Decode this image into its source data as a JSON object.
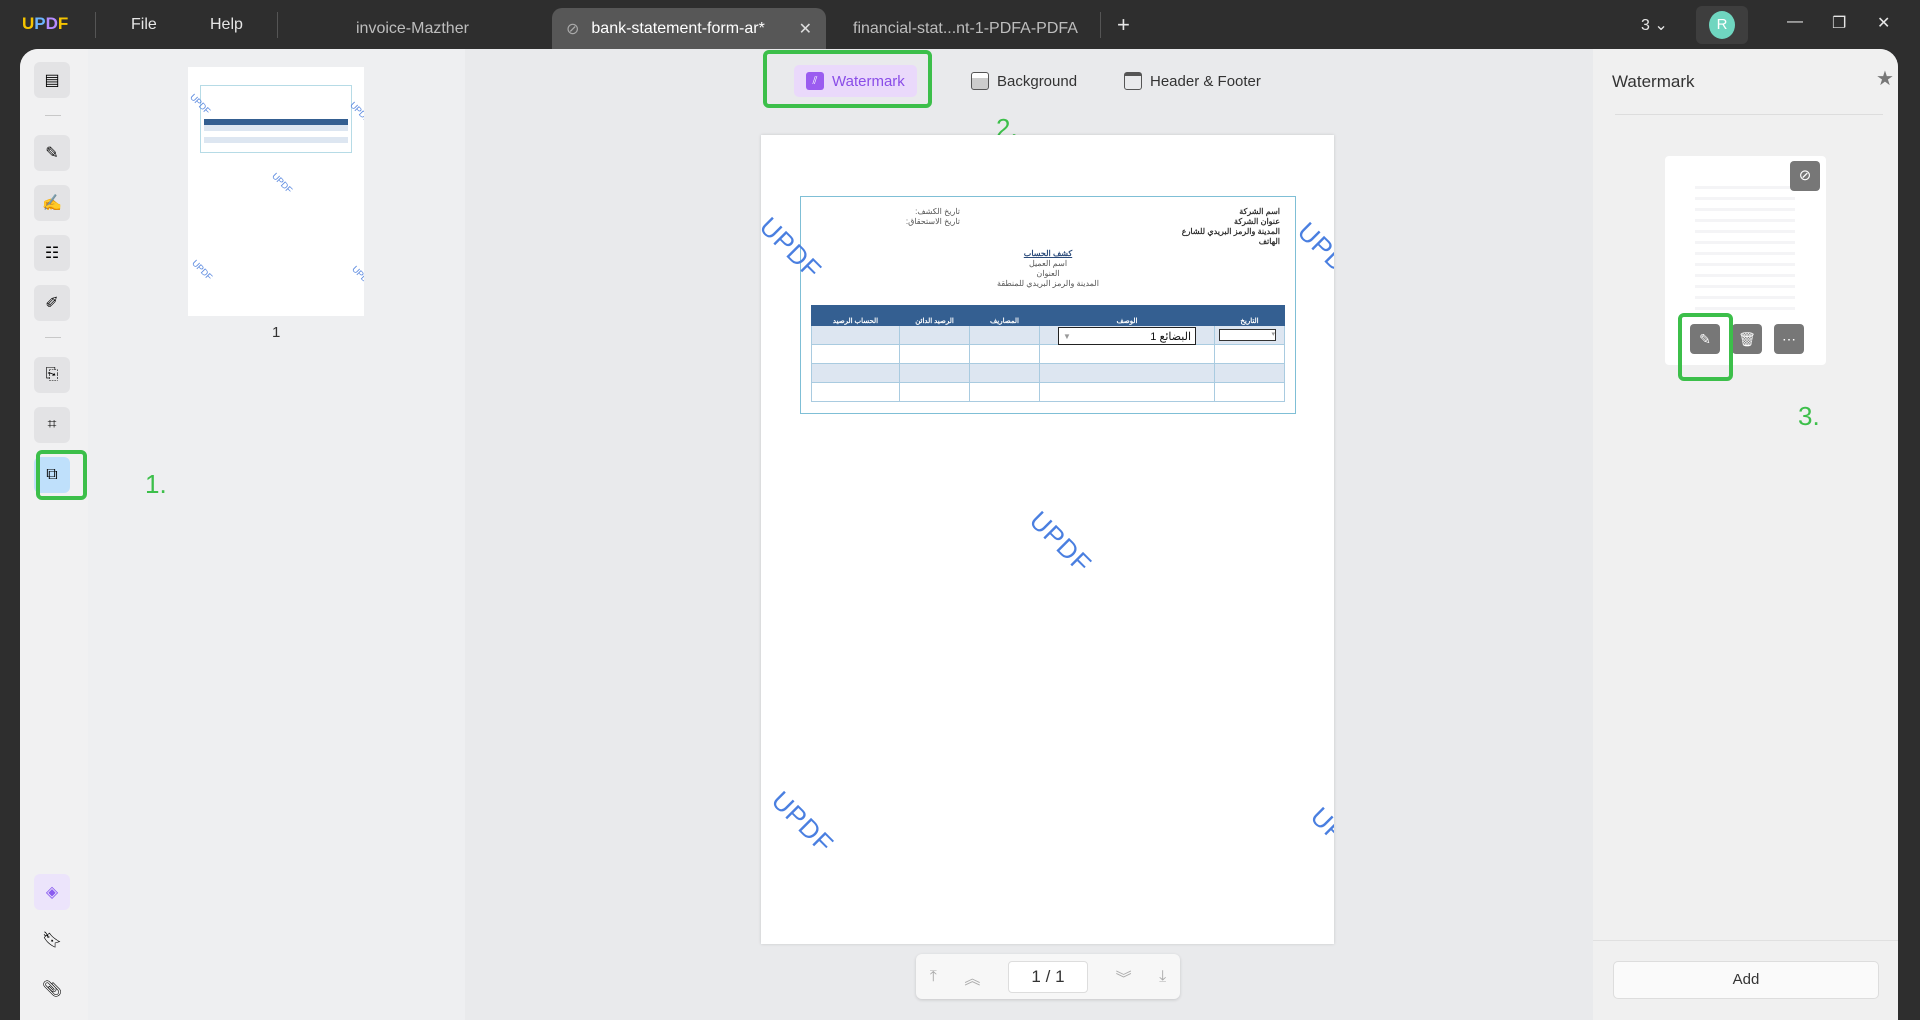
{
  "app": {
    "logo": "UPDF",
    "menu": [
      "File",
      "Help"
    ]
  },
  "tabs": [
    {
      "label": "invoice-Mazther"
    },
    {
      "label": "bank-statement-form-ar*",
      "active": true
    },
    {
      "label": "financial-stat...nt-1-PDFA-PDFA"
    }
  ],
  "titlebar": {
    "count": "3",
    "avatar": "R",
    "avatar_color": "#6fd6c0"
  },
  "toolbar": {
    "watermark": "Watermark",
    "background": "Background",
    "header_footer": "Header & Footer"
  },
  "annotations": {
    "step1": "1.",
    "step2": "2.",
    "step3": "3.",
    "highlight_color": "#3cbf4a"
  },
  "thumbnails": [
    {
      "page": "1"
    }
  ],
  "document": {
    "watermark_text": "UPDF",
    "company": [
      "اسم الشركة",
      "عنوان الشركة",
      "المدينة والرمز البريدي للشارع",
      "الهاتف"
    ],
    "dates": [
      "تاريخ الكشف:",
      "تاريخ الاستحقاق:"
    ],
    "title": "كشف الحساب",
    "customer": [
      "اسم العميل",
      "العنوان",
      "المدينة والرمز البريدي للمنطقة"
    ],
    "columns": [
      "التاريخ",
      "الوصف",
      "المصاريف",
      "الرصيد الدائن",
      "الحساب الرصيد"
    ],
    "description_value": "البضائع 1"
  },
  "pager": {
    "current": "1",
    "separator": "/",
    "total": "1"
  },
  "panel": {
    "title": "Watermark",
    "add": "Add"
  }
}
